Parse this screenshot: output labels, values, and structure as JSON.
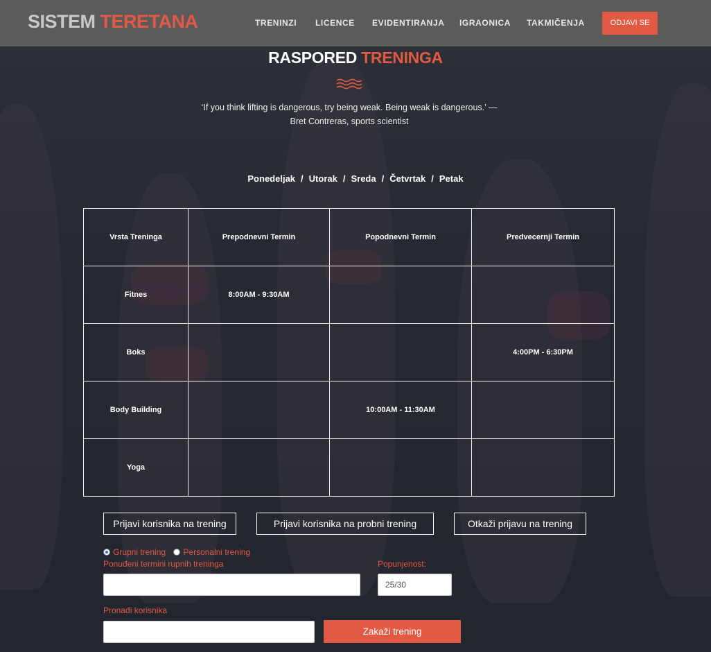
{
  "brand": {
    "part1": "SISTEM",
    "part2": "TERETANA"
  },
  "nav": {
    "items": [
      "TRENINZI",
      "LICENCE",
      "EVIDENTIRANJA",
      "IGRAONICA",
      "TAKMIČENJA"
    ],
    "logout": "ODJAVI SE"
  },
  "heading": {
    "part1": "RASPORED",
    "part2": "TRENINGA"
  },
  "quote": "‘If you think lifting is dangerous, try being weak. Being weak is dangerous.’ — Bret Contreras, sports scientist",
  "days": [
    "Ponedeljak",
    "Utorak",
    "Sreda",
    "Četvrtak",
    "Petak"
  ],
  "day_separator": "/",
  "table": {
    "headers": [
      "Vrsta Treninga",
      "Prepodnevni Termin",
      "Popodnevni Termin",
      "Predvecernji Termin"
    ],
    "rows": [
      [
        "Fitnes",
        "8:00AM - 9:30AM",
        "",
        ""
      ],
      [
        "Boks",
        "",
        "",
        "4:00PM - 6:30PM"
      ],
      [
        "Body Building",
        "",
        "10:00AM - 11:30AM",
        ""
      ],
      [
        "Yoga",
        "",
        "",
        ""
      ]
    ]
  },
  "actions": {
    "register": "Prijavi korisnika na trening",
    "register_trial": "Prijavi korisnika na probni trening",
    "cancel": "Otkaži prijavu na trening"
  },
  "form": {
    "radio_group": "Grupni trening",
    "radio_personal": "Personalni trening",
    "terms_label": "Ponuđeni termini rupnih treninga",
    "terms_value": "",
    "occupancy_label": "Popunjenost:",
    "occupancy_value": "25/30",
    "find_user_label": "Pronađi korisnika",
    "find_user_value": "",
    "schedule_button": "Zakaži trening"
  },
  "colors": {
    "accent": "#e25a44",
    "navbar": "#5f5f5f"
  }
}
